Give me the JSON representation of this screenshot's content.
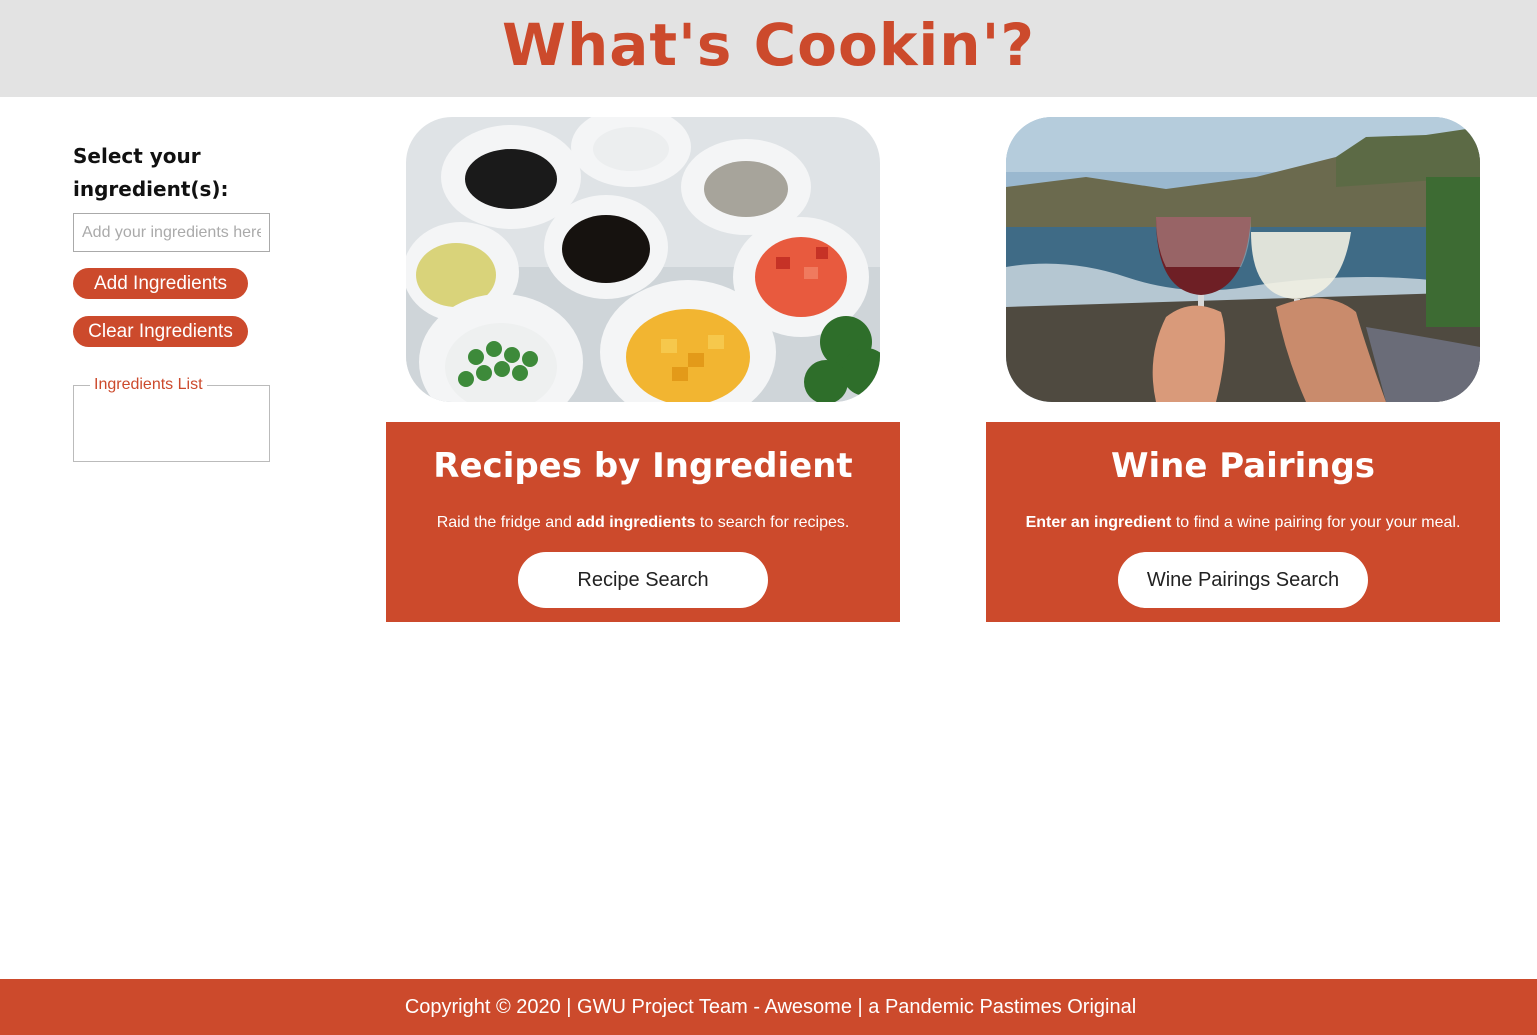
{
  "header": {
    "title": "What's Cookin'?"
  },
  "sidebar": {
    "select_label": "Select your ingredient(s):",
    "input_placeholder": "Add your ingredients here",
    "input_value": "",
    "add_button": "Add Ingredients",
    "clear_button": "Clear Ingredients",
    "list_legend": "Ingredients List",
    "list_items": []
  },
  "cards": {
    "recipes": {
      "title": "Recipes by Ingredient",
      "desc_pre": "Raid the fridge and ",
      "desc_bold": "add ingredients",
      "desc_post": " to search for recipes.",
      "button": "Recipe Search"
    },
    "wine": {
      "title": "Wine Pairings",
      "desc_pre": "",
      "desc_bold": "Enter an ingredient",
      "desc_post": " to find a wine pairing for your your meal.",
      "button": "Wine Pairings Search"
    }
  },
  "footer": {
    "text": "Copyright © 2020 | GWU Project Team - Awesome | a Pandemic Pastimes Original"
  },
  "colors": {
    "accent": "#cc4a2c",
    "header_bg": "#e3e3e3"
  }
}
